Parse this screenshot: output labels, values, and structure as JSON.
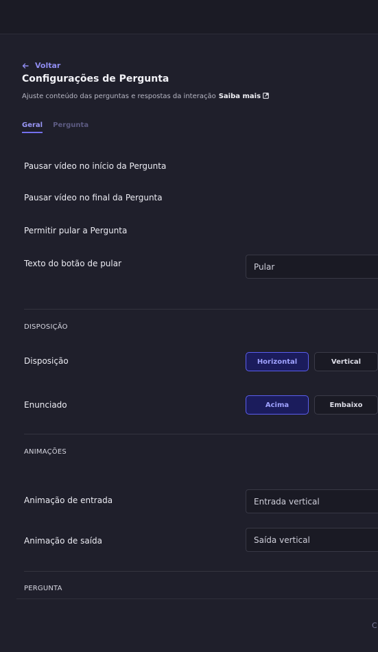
{
  "header": {
    "back_label": "Voltar",
    "title": "Configurações de Pergunta",
    "subtitle": "Ajuste conteúdo das perguntas e respostas da interação",
    "learn_more": "Saiba mais"
  },
  "tabs": [
    {
      "label": "Geral",
      "active": true
    },
    {
      "label": "Pergunta",
      "active": false
    }
  ],
  "settings": {
    "pause_start": "Pausar vídeo no início da Pergunta",
    "pause_end": "Pausar vídeo no final da Pergunta",
    "allow_skip": "Permitir pular a Pergunta",
    "skip_button_text_label": "Texto do botão de pular",
    "skip_button_text_value": "Pular"
  },
  "layout_section": {
    "heading": "DISPOSIÇÃO",
    "disposition_label": "Disposição",
    "disposition_options": [
      "Horizontal",
      "Vertical"
    ],
    "disposition_selected": "Horizontal",
    "statement_label": "Enunciado",
    "statement_options": [
      "Acima",
      "Embaixo"
    ],
    "statement_selected": "Acima"
  },
  "animations_section": {
    "heading": "ANIMAÇÕES",
    "entry_label": "Animação de entrada",
    "entry_value": "Entrada vertical",
    "exit_label": "Animação de saída",
    "exit_value": "Saída vertical"
  },
  "question_section": {
    "heading": "PERGUNTA"
  },
  "corner_glyph": "C",
  "colors": {
    "background": "#1f1f2b",
    "accent": "#7470ee",
    "selected_bg": "#1b1c5c"
  }
}
